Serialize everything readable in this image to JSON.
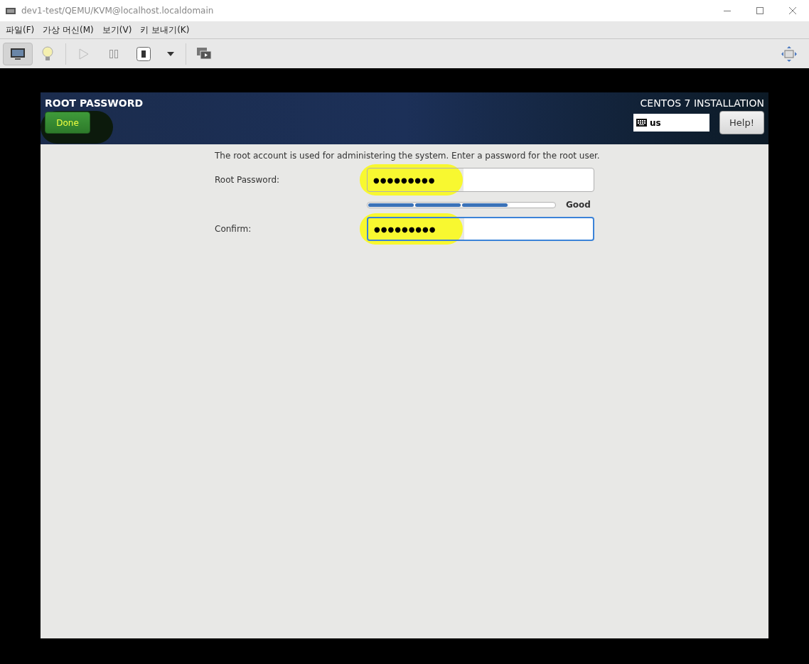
{
  "window": {
    "title": "dev1-test/QEMU/KVM@localhost.localdomain"
  },
  "menu": [
    {
      "label": "파일(F)"
    },
    {
      "label": "가상 머신(M)"
    },
    {
      "label": "보기(V)"
    },
    {
      "label": "키 보내기(K)"
    }
  ],
  "toolbar": {
    "console_selected": true
  },
  "installer": {
    "title": "ROOT PASSWORD",
    "product": "CENTOS 7 INSTALLATION",
    "done_button": "Done",
    "keyboard_layout": "us",
    "help_button": "Help!",
    "description": "The root account is used for administering the system.  Enter a password for the root user.",
    "fields": [
      {
        "label": "Root Password:",
        "value": "●●●●●●●●●",
        "focused": false
      },
      {
        "label": "Confirm:",
        "value": "●●●●●●●●●",
        "focused": true
      }
    ],
    "strength": {
      "level": 0.75,
      "label": "Good"
    }
  }
}
